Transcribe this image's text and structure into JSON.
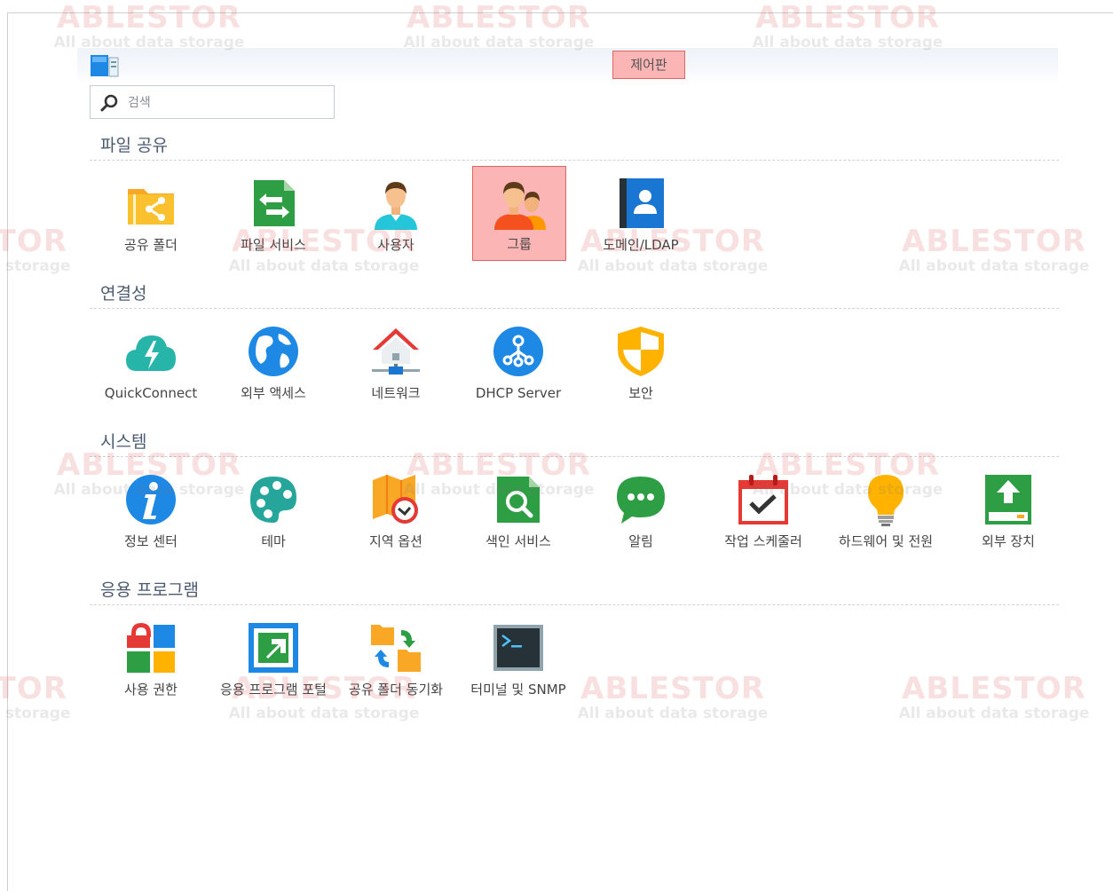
{
  "window": {
    "title": "제어판"
  },
  "search": {
    "placeholder": "검색"
  },
  "watermark": {
    "brand": "ABLESTOR",
    "tagline": "All about data storage"
  },
  "sections": [
    {
      "title": "파일 공유",
      "items": [
        "공유 폴더",
        "파일 서비스",
        "사용자",
        "그룹",
        "도메인/LDAP"
      ]
    },
    {
      "title": "연결성",
      "items": [
        "QuickConnect",
        "외부 액세스",
        "네트워크",
        "DHCP Server",
        "보안"
      ]
    },
    {
      "title": "시스템",
      "items": [
        "정보 센터",
        "테마",
        "지역 옵션",
        "색인 서비스",
        "알림",
        "작업 스케줄러",
        "하드웨어 및 전원",
        "외부 장치"
      ]
    },
    {
      "title": "응용 프로그램",
      "items": [
        "사용 권한",
        "응용 프로그램 포털",
        "공유 폴더 동기화",
        "터미널 및 SNMP"
      ]
    }
  ],
  "selected_item": "그룹",
  "colors": {
    "accent": "#fbb5b5",
    "accent_border": "#e06666",
    "section_title": "#4a5a70"
  }
}
